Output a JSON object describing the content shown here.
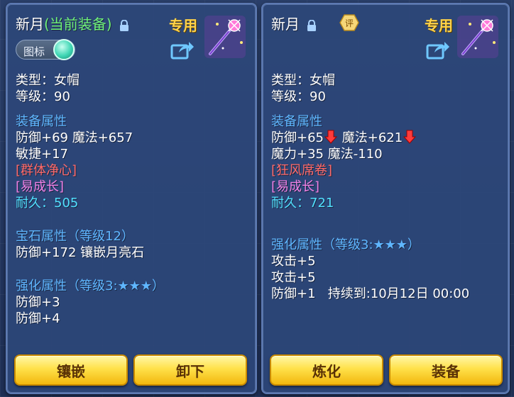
{
  "left_panel": {
    "name": "新月",
    "current_tag": "(当前装备)",
    "exclusive_label": "专用",
    "toggle_label": "图标",
    "type_line": "类型：女帽",
    "level_line": "等级：90",
    "equip_attr_title": "装备属性",
    "equip_attr_1": "防御+69 魔法+657",
    "equip_attr_2": "敏捷+17",
    "special_1": "[群体净心]",
    "special_2": "[易成长]",
    "durability_label": "耐久：",
    "durability_value": "505",
    "gem_title": "宝石属性（等级12）",
    "gem_attr": "防御+172 镶嵌月亮石",
    "enhance_title": "强化属性（等级3:★★★）",
    "enhance_1": "防御+3",
    "enhance_2": "防御+4",
    "buttons": [
      "镶嵌",
      "卸下"
    ],
    "icons": [
      "lock-icon",
      "share-icon",
      "wand-icon"
    ]
  },
  "right_panel": {
    "name": "新月",
    "badge": "评",
    "exclusive_label": "专用",
    "type_line": "类型：女帽",
    "level_line": "等级：90",
    "equip_attr_title": "装备属性",
    "equip_attr_1a": "防御+65",
    "equip_attr_1b": "魔法+621",
    "equip_attr_2": "魔力+35 魔法-110",
    "special_1": "[狂风席卷]",
    "special_2": "[易成长]",
    "durability_label": "耐久：",
    "durability_value": "721",
    "enhance_title": "强化属性（等级3:★★★）",
    "enhance_1": "攻击+5",
    "enhance_2": "攻击+5",
    "enhance_3a": "防御+1",
    "enhance_3b": "持续到:10月12日 00:00",
    "buttons": [
      "炼化",
      "装备"
    ],
    "icons": [
      "lock-icon",
      "rating-badge-icon",
      "share-icon",
      "wand-icon",
      "down-arrow-icon"
    ]
  },
  "colors": {
    "current_tag": "#6ff07a",
    "exclusive": "#ffd34a",
    "section_title": "#5fb6ff",
    "special": "#f081e6",
    "durability": "#52e0ff",
    "button": "#ffe14a"
  }
}
